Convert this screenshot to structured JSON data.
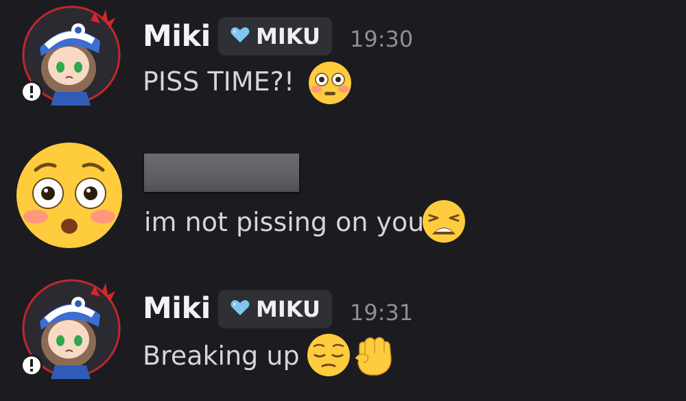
{
  "messages": [
    {
      "username": "Miki",
      "tag": "MIKU",
      "time": "19:30",
      "text": "PISS TIME?!",
      "emoji": [
        "flushed-face-icon"
      ]
    },
    {
      "username": "",
      "text": "im not pissing on you",
      "emoji": [
        "weary-face-icon"
      ],
      "avatar": "flushed-face-icon"
    },
    {
      "username": "Miki",
      "tag": "MIKU",
      "time": "19:31",
      "text": "Breaking up",
      "emoji": [
        "pensive-face-icon",
        "raised-fist-icon"
      ]
    }
  ],
  "colors": {
    "background": "#1b1b20",
    "tag_background": "#2f3036",
    "heart": "#7ec8f0",
    "emoji_yellow": "#ffcc3d"
  }
}
